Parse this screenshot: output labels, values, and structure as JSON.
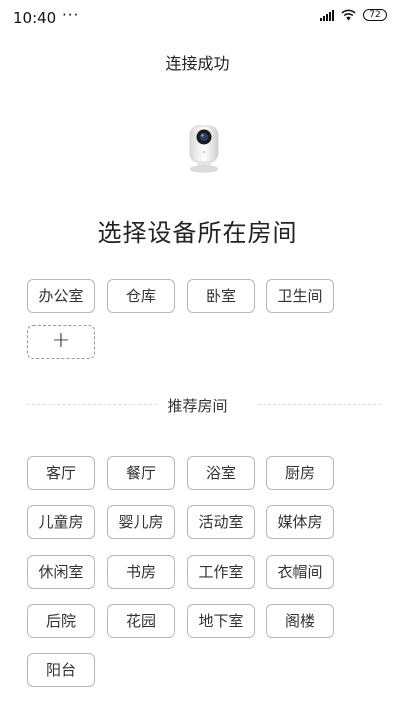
{
  "status_bar": {
    "time": "10:40",
    "notification_dots": "···",
    "battery_level": "72"
  },
  "header": {
    "title": "连接成功"
  },
  "device": {
    "icon": "camera-icon"
  },
  "main": {
    "heading": "选择设备所在房间"
  },
  "current_rooms": {
    "items": [
      "办公室",
      "仓库",
      "卧室",
      "卫生间"
    ],
    "add_label": "+"
  },
  "recommended": {
    "section_label": "推荐房间",
    "items": [
      "客厅",
      "餐厅",
      "浴室",
      "厨房",
      "儿童房",
      "婴儿房",
      "活动室",
      "媒体房",
      "休闲室",
      "书房",
      "工作室",
      "衣帽间",
      "后院",
      "花园",
      "地下室",
      "阁楼",
      "阳台"
    ]
  }
}
